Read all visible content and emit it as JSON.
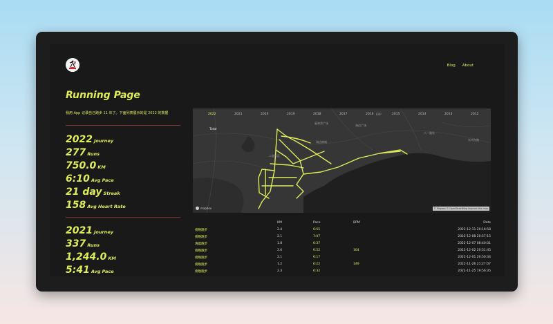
{
  "nav": {
    "blog": "Blog",
    "about": "About"
  },
  "page_title": "Running Page",
  "description": "我用 App 记录自己跑步 11 年了。下面列表展示的是 2022 的数据",
  "stats_2022": [
    {
      "value": "2022",
      "unit": "Journey"
    },
    {
      "value": "277",
      "unit": "Runs"
    },
    {
      "value": "750.0",
      "unit": "KM"
    },
    {
      "value": "6:10",
      "unit": "Avg Pace"
    },
    {
      "value": "21 day",
      "unit": "Streak"
    },
    {
      "value": "158",
      "unit": "Avg Heart Rate"
    }
  ],
  "stats_2021": [
    {
      "value": "2021",
      "unit": "Journey"
    },
    {
      "value": "337",
      "unit": "Runs"
    },
    {
      "value": "1,244.0",
      "unit": "KM"
    },
    {
      "value": "5:41",
      "unit": "Avg Pace"
    }
  ],
  "map": {
    "years": [
      "2022",
      "2021",
      "2020",
      "2019",
      "2018",
      "2017",
      "2016",
      "2015",
      "2014",
      "2013",
      "2012"
    ],
    "active_year": "2022",
    "total_label": "Total",
    "mapbox_label": "mapbox",
    "attribution": "© Mapbox © OpenStreetMap  Improve this map",
    "route_color": "#e0ed5a",
    "places": [
      "ERP",
      "星海湾广场",
      "海边广场",
      "海边商城",
      "八一路东",
      "光州东路",
      "二道街区"
    ]
  },
  "runs": {
    "headers": {
      "name": "",
      "km": "KM",
      "pace": "Pace",
      "bpm": "BPM",
      "date": "Date"
    },
    "rows": [
      {
        "name": "傍晚跑步",
        "km": "2.4",
        "pace": "6:55",
        "bpm": "",
        "date": "2022-12-11 20:16:58"
      },
      {
        "name": "傍晚跑步",
        "km": "2.1",
        "pace": "7:07",
        "bpm": "",
        "date": "2022-12-08 20:57:15"
      },
      {
        "name": "清晨跑步",
        "km": "1.8",
        "pace": "6:37",
        "bpm": "",
        "date": "2022-12-07 08:40:01"
      },
      {
        "name": "傍晚跑步",
        "km": "2.6",
        "pace": "6:52",
        "bpm": "164",
        "date": "2022-12-02 20:51:45"
      },
      {
        "name": "傍晚跑步",
        "km": "2.1",
        "pace": "6:17",
        "bpm": "",
        "date": "2022-12-01 20:50:34"
      },
      {
        "name": "傍晚跑步",
        "km": "1.2",
        "pace": "6:22",
        "bpm": "149",
        "date": "2022-11-26 21:27:07"
      },
      {
        "name": "傍晚跑步",
        "km": "2.3",
        "pace": "6:32",
        "bpm": "",
        "date": "2022-11-25 19:56:35"
      }
    ]
  }
}
